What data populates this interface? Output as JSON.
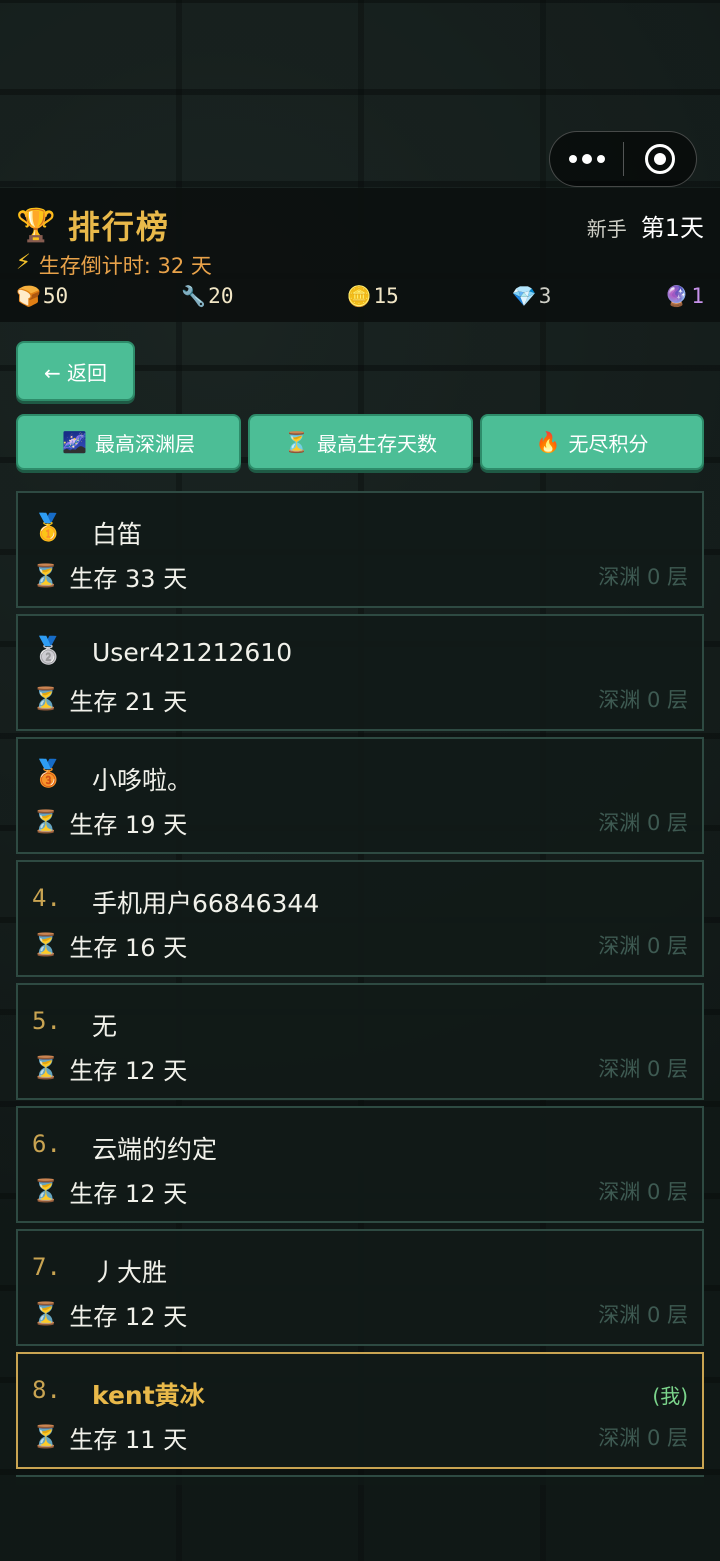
{
  "header": {
    "title": "排行榜",
    "level": "新手",
    "day": "第1天",
    "countdown": "生存倒计时: 32 天",
    "resources": [
      {
        "icon": "bread-icon",
        "glyph": "🍞",
        "value": "50"
      },
      {
        "icon": "wrench-icon",
        "glyph": "🔧",
        "value": "20"
      },
      {
        "icon": "coin-icon",
        "glyph": "🪙",
        "value": "15"
      },
      {
        "icon": "gem-icon",
        "glyph": "💎",
        "value": "3"
      },
      {
        "icon": "crystal-ball-icon",
        "glyph": "🔮",
        "value": "1"
      }
    ]
  },
  "back_label": "← 返回",
  "tabs": [
    {
      "icon": "🌌",
      "label": "最高深渊层"
    },
    {
      "icon": "⏳",
      "label": "最高生存天数"
    },
    {
      "icon": "🔥",
      "label": "无尽积分"
    }
  ],
  "leaderboard": [
    {
      "rank": "",
      "medal": "🥇",
      "name": "白笛",
      "survive": "生存 33 天",
      "abyss": "深渊 0 层",
      "self": ""
    },
    {
      "rank": "",
      "medal": "🥈",
      "name": "User421212610",
      "survive": "生存 21 天",
      "abyss": "深渊 0 层",
      "self": ""
    },
    {
      "rank": "",
      "medal": "🥉",
      "name": "小哆啦。",
      "survive": "生存 19 天",
      "abyss": "深渊 0 层",
      "self": ""
    },
    {
      "rank": "4.",
      "medal": "",
      "name": "手机用户66846344",
      "survive": "生存 16 天",
      "abyss": "深渊 0 层",
      "self": ""
    },
    {
      "rank": "5.",
      "medal": "",
      "name": "无",
      "survive": "生存 12 天",
      "abyss": "深渊 0 层",
      "self": ""
    },
    {
      "rank": "6.",
      "medal": "",
      "name": "云端的约定",
      "survive": "生存 12 天",
      "abyss": "深渊 0 层",
      "self": ""
    },
    {
      "rank": "7.",
      "medal": "",
      "name": "丿大胜",
      "survive": "生存 12 天",
      "abyss": "深渊 0 层",
      "self": ""
    },
    {
      "rank": "8.",
      "medal": "",
      "name": "kent黄冰",
      "survive": "生存 11 天",
      "abyss": "深渊 0 层",
      "self": "(我)"
    }
  ]
}
